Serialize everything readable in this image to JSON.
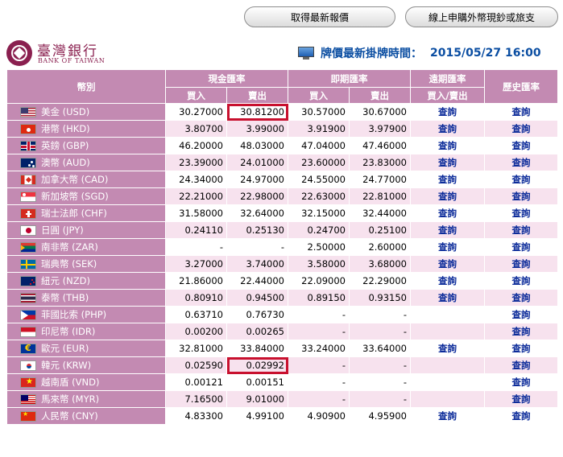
{
  "top_buttons": {
    "latest_rates": "取得最新報價",
    "online_purchase": "線上申購外幣現鈔或旅支"
  },
  "logo": {
    "name_cn": "臺灣銀行",
    "name_en": "BANK OF TAIWAN"
  },
  "update": {
    "label": "牌價最新掛牌時間：",
    "time": "2015/05/27 16:00"
  },
  "headers": {
    "currency": "幣別",
    "cash": "現金匯率",
    "spot": "即期匯率",
    "forward": "遠期匯率",
    "history": "歷史匯率",
    "buy": "買入",
    "sell": "賣出",
    "buy_sell": "買入/賣出"
  },
  "link_text": "查詢",
  "rows": [
    {
      "flag": "usd",
      "name": "美金 (USD)",
      "cash_buy": "30.27000",
      "cash_sell": "30.81200",
      "spot_buy": "30.57000",
      "spot_sell": "30.67000",
      "forward": "查詢",
      "history": "查詢"
    },
    {
      "flag": "hkd",
      "name": "港幣 (HKD)",
      "cash_buy": "3.80700",
      "cash_sell": "3.99000",
      "spot_buy": "3.91900",
      "spot_sell": "3.97900",
      "forward": "查詢",
      "history": "查詢"
    },
    {
      "flag": "gbp",
      "name": "英鎊 (GBP)",
      "cash_buy": "46.20000",
      "cash_sell": "48.03000",
      "spot_buy": "47.04000",
      "spot_sell": "47.46000",
      "forward": "查詢",
      "history": "查詢"
    },
    {
      "flag": "aud",
      "name": "澳幣 (AUD)",
      "cash_buy": "23.39000",
      "cash_sell": "24.01000",
      "spot_buy": "23.60000",
      "spot_sell": "23.83000",
      "forward": "查詢",
      "history": "查詢"
    },
    {
      "flag": "cad",
      "name": "加拿大幣 (CAD)",
      "cash_buy": "24.34000",
      "cash_sell": "24.97000",
      "spot_buy": "24.55000",
      "spot_sell": "24.77000",
      "forward": "查詢",
      "history": "查詢"
    },
    {
      "flag": "sgd",
      "name": "新加坡幣 (SGD)",
      "cash_buy": "22.21000",
      "cash_sell": "22.98000",
      "spot_buy": "22.63000",
      "spot_sell": "22.81000",
      "forward": "查詢",
      "history": "查詢"
    },
    {
      "flag": "chf",
      "name": "瑞士法郎 (CHF)",
      "cash_buy": "31.58000",
      "cash_sell": "32.64000",
      "spot_buy": "32.15000",
      "spot_sell": "32.44000",
      "forward": "查詢",
      "history": "查詢"
    },
    {
      "flag": "jpy",
      "name": "日圓 (JPY)",
      "cash_buy": "0.24110",
      "cash_sell": "0.25130",
      "spot_buy": "0.24700",
      "spot_sell": "0.25100",
      "forward": "查詢",
      "history": "查詢"
    },
    {
      "flag": "zar",
      "name": "南非幣 (ZAR)",
      "cash_buy": "-",
      "cash_sell": "-",
      "spot_buy": "2.50000",
      "spot_sell": "2.60000",
      "forward": "查詢",
      "history": "查詢"
    },
    {
      "flag": "sek",
      "name": "瑞典幣 (SEK)",
      "cash_buy": "3.27000",
      "cash_sell": "3.74000",
      "spot_buy": "3.58000",
      "spot_sell": "3.68000",
      "forward": "查詢",
      "history": "查詢"
    },
    {
      "flag": "nzd",
      "name": "紐元 (NZD)",
      "cash_buy": "21.86000",
      "cash_sell": "22.44000",
      "spot_buy": "22.09000",
      "spot_sell": "22.29000",
      "forward": "查詢",
      "history": "查詢"
    },
    {
      "flag": "thb",
      "name": "泰幣 (THB)",
      "cash_buy": "0.80910",
      "cash_sell": "0.94500",
      "spot_buy": "0.89150",
      "spot_sell": "0.93150",
      "forward": "查詢",
      "history": "查詢"
    },
    {
      "flag": "php",
      "name": "菲國比索 (PHP)",
      "cash_buy": "0.63710",
      "cash_sell": "0.76730",
      "spot_buy": "-",
      "spot_sell": "-",
      "forward": "",
      "history": "查詢"
    },
    {
      "flag": "idr",
      "name": "印尼幣 (IDR)",
      "cash_buy": "0.00200",
      "cash_sell": "0.00265",
      "spot_buy": "-",
      "spot_sell": "-",
      "forward": "",
      "history": "查詢"
    },
    {
      "flag": "eur",
      "name": "歐元 (EUR)",
      "cash_buy": "32.81000",
      "cash_sell": "33.84000",
      "spot_buy": "33.24000",
      "spot_sell": "33.64000",
      "forward": "查詢",
      "history": "查詢"
    },
    {
      "flag": "krw",
      "name": "韓元 (KRW)",
      "cash_buy": "0.02590",
      "cash_sell": "0.02992",
      "spot_buy": "-",
      "spot_sell": "-",
      "forward": "",
      "history": "查詢"
    },
    {
      "flag": "vnd",
      "name": "越南盾 (VND)",
      "cash_buy": "0.00121",
      "cash_sell": "0.00151",
      "spot_buy": "-",
      "spot_sell": "-",
      "forward": "",
      "history": "查詢"
    },
    {
      "flag": "myr",
      "name": "馬來幣 (MYR)",
      "cash_buy": "7.16500",
      "cash_sell": "9.01000",
      "spot_buy": "-",
      "spot_sell": "-",
      "forward": "",
      "history": "查詢"
    },
    {
      "flag": "cny",
      "name": "人民幣 (CNY)",
      "cash_buy": "4.83300",
      "cash_sell": "4.99100",
      "spot_buy": "4.90900",
      "spot_sell": "4.95900",
      "forward": "查詢",
      "history": "查詢"
    }
  ],
  "highlighted_cells": [
    {
      "row": 0,
      "field": "cash_sell"
    },
    {
      "row": 15,
      "field": "cash_sell"
    }
  ],
  "colors": {
    "header_bg": "#c38ab2",
    "row_alt_bg": "#f7e2ee",
    "link": "#0d2c9a",
    "time_text": "#0b4ea2",
    "highlight_border": "#c8102e",
    "brand": "#8a1f4f"
  }
}
